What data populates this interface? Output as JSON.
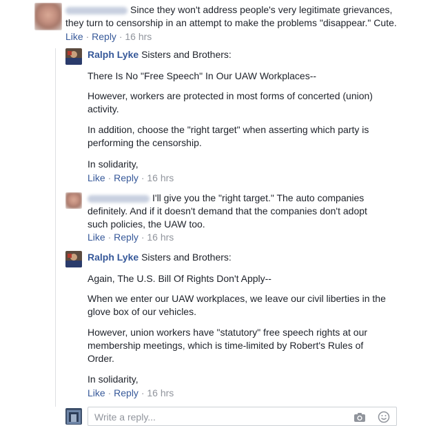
{
  "comments": [
    {
      "author": "",
      "text": "Since they won't address people's very legitimate grievances, they turn to censorship in an attempt to make the problems \"disappear.\" Cute.",
      "line1": "Since they won't address people's very legitimate grievances,",
      "line2": "they turn to censorship in an attempt to make the problems \"disappear.\" Cute.",
      "like": "Like",
      "reply": "Reply",
      "time": "16 hrs"
    }
  ],
  "replies": [
    {
      "author": "Ralph Lyke",
      "first": "Sisters and Brothers:",
      "p1": "There Is No \"Free Speech\" In Our UAW Workplaces--",
      "p2a": "However, workers are protected in most forms of concerted (union)",
      "p2b": "activity.",
      "p3a": "In addition, choose the \"right target\" when asserting which party is",
      "p3b": "performing the censorship.",
      "p4": "In solidarity,",
      "like": "Like",
      "reply": "Reply",
      "time": "16 hrs"
    },
    {
      "author": "",
      "l1": "I'll give you the \"right target.\" The auto companies",
      "l2": "definitely. And if it doesn't demand that the companies don't adopt",
      "l3": "such policies, the UAW too.",
      "like": "Like",
      "reply": "Reply",
      "time": "16 hrs"
    },
    {
      "author": "Ralph Lyke",
      "first": "Sisters and Brothers:",
      "p1": "Again, The U.S. Bill Of Rights Don't Apply--",
      "p2a": "When we enter our UAW workplaces, we leave our civil liberties in the",
      "p2b": "glove box of our vehicles.",
      "p3a": "However, union workers have \"statutory\" free speech rights at our",
      "p3b": "membership meetings, which is time-limited by Robert's Rules of",
      "p3c": "Order.",
      "p4": "In solidarity,",
      "like": "Like",
      "reply": "Reply",
      "time": "16 hrs"
    }
  ],
  "reply_box": {
    "placeholder": "Write a reply..."
  },
  "sep": "·",
  "colors": {
    "link": "#365899",
    "meta": "#90949c",
    "text": "#1d2129",
    "border": "#ccd0d5"
  },
  "icons": [
    "camera-icon",
    "smiley-icon"
  ]
}
